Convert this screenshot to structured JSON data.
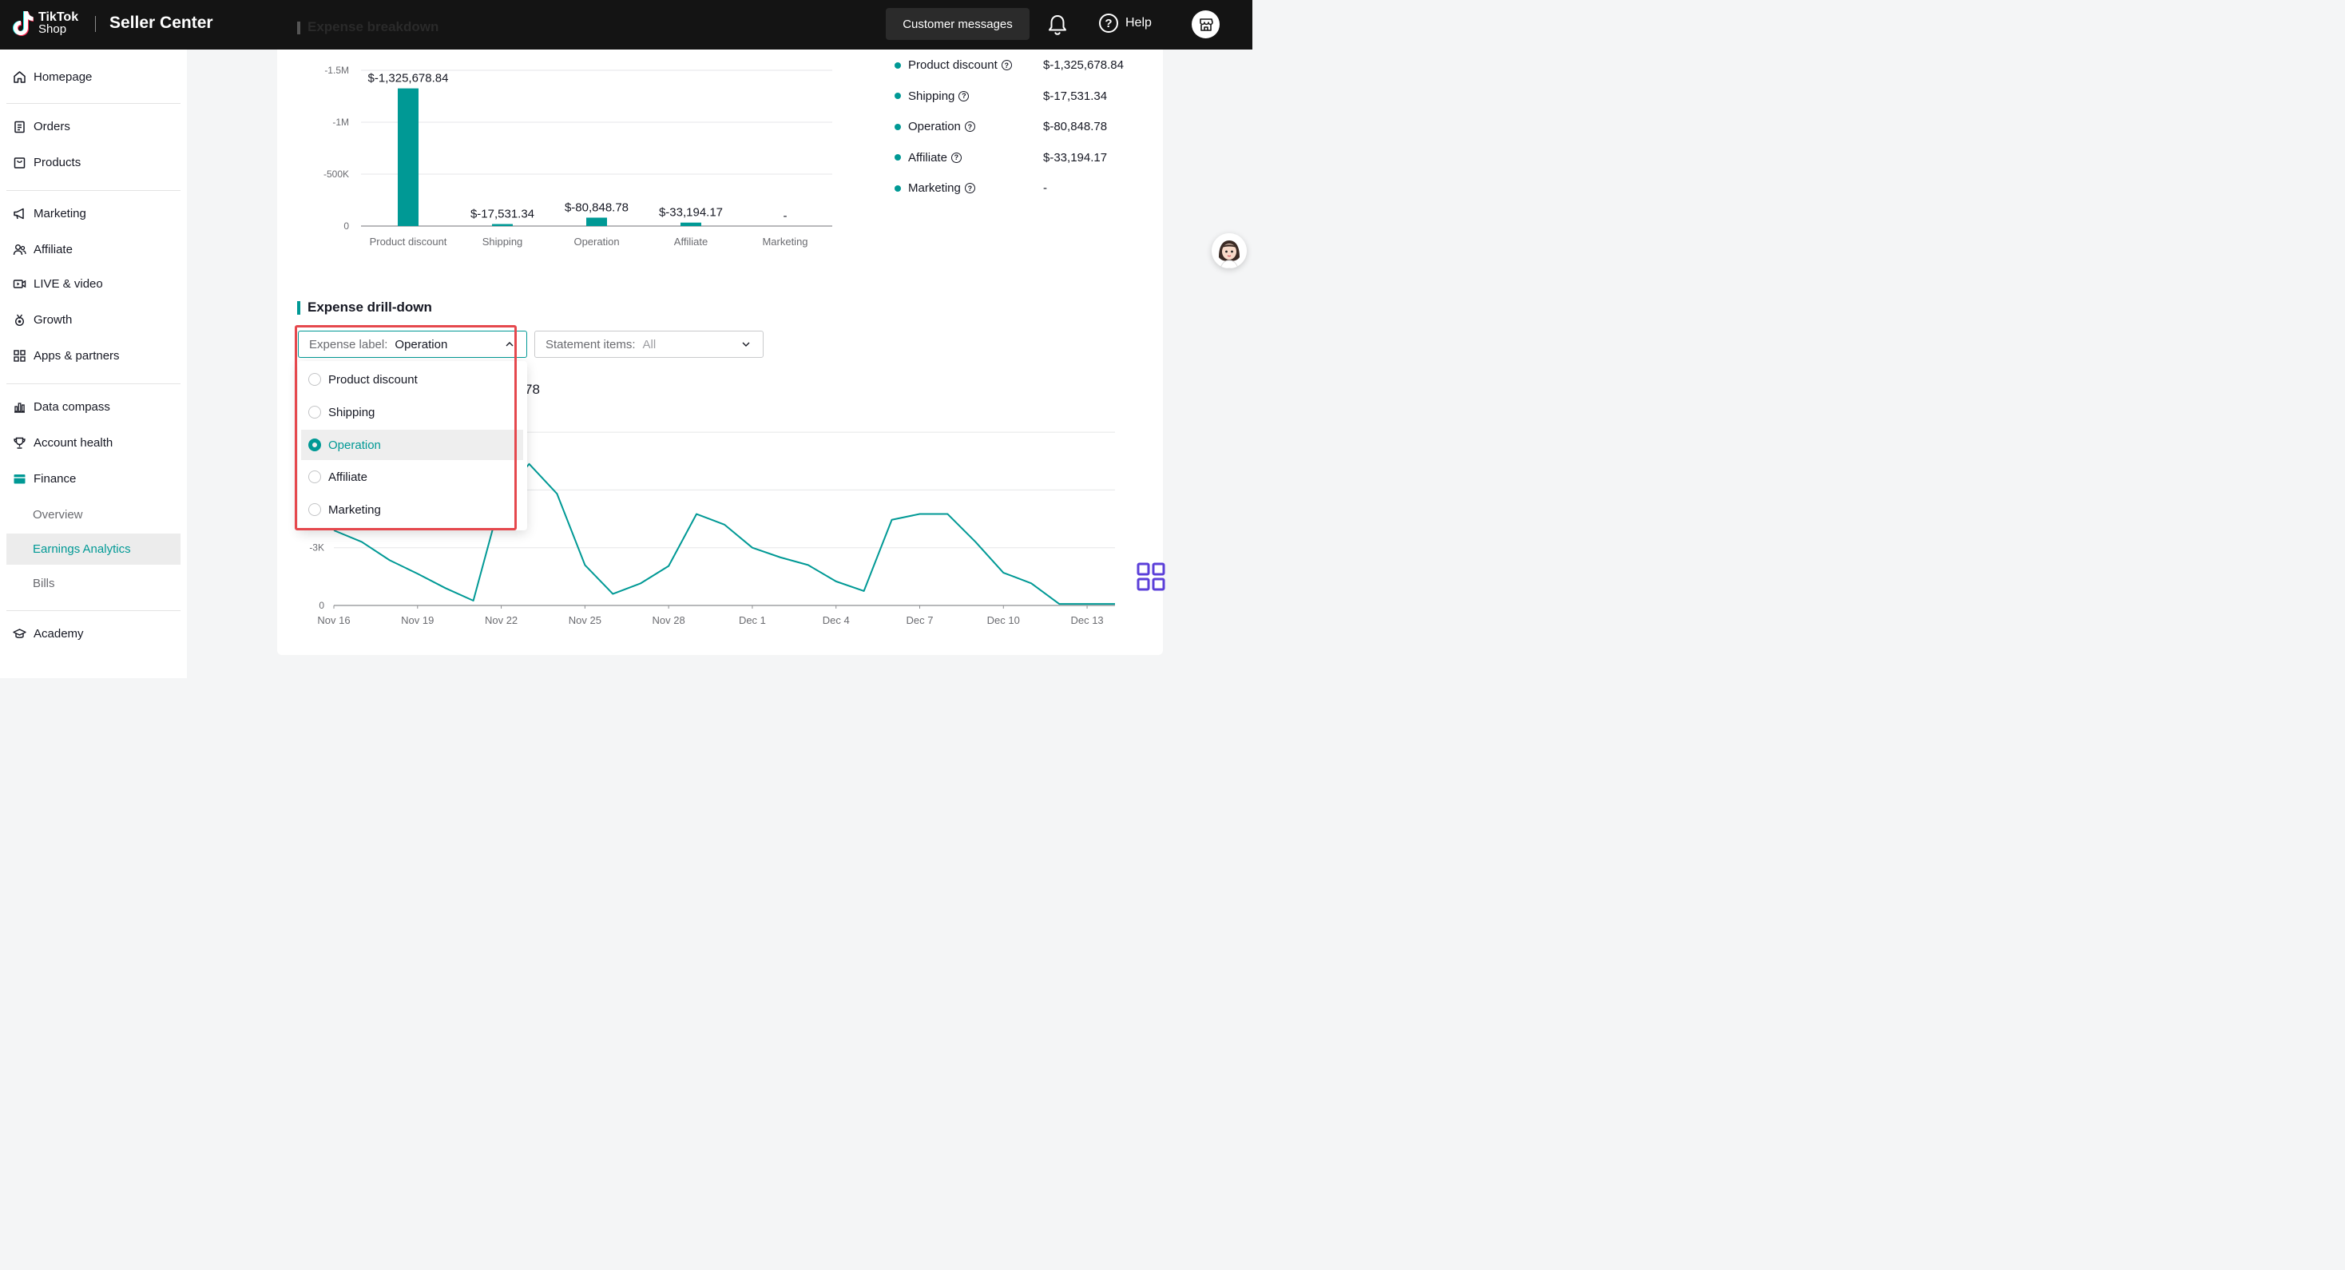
{
  "header": {
    "logo_line1": "TikTok",
    "logo_line2": "Shop",
    "app_title": "Seller Center",
    "messages_label": "Customer messages",
    "help_label": "Help"
  },
  "sidebar": {
    "items": [
      {
        "label": "Homepage",
        "icon": "home-icon"
      },
      {
        "label": "Orders",
        "icon": "clipboard-icon"
      },
      {
        "label": "Products",
        "icon": "bag-icon"
      },
      {
        "label": "Marketing",
        "icon": "megaphone-icon"
      },
      {
        "label": "Affiliate",
        "icon": "users-icon"
      },
      {
        "label": "LIVE & video",
        "icon": "video-icon"
      },
      {
        "label": "Growth",
        "icon": "medal-icon"
      },
      {
        "label": "Apps & partners",
        "icon": "apps-icon"
      },
      {
        "label": "Data compass",
        "icon": "chart-icon"
      },
      {
        "label": "Account health",
        "icon": "trophy-icon"
      },
      {
        "label": "Finance",
        "icon": "wallet-icon"
      },
      {
        "label": "Academy",
        "icon": "graduation-cap-icon"
      }
    ],
    "finance_sub": [
      "Overview",
      "Earnings Analytics",
      "Bills"
    ],
    "active_sub": "Earnings Analytics"
  },
  "breakdown": {
    "title": "Expense breakdown",
    "legend": [
      {
        "label": "Product discount",
        "value": "$-1,325,678.84"
      },
      {
        "label": "Shipping",
        "value": "$-17,531.34"
      },
      {
        "label": "Operation",
        "value": "$-80,848.78"
      },
      {
        "label": "Affiliate",
        "value": "$-33,194.17"
      },
      {
        "label": "Marketing",
        "value": "-"
      }
    ]
  },
  "drilldown": {
    "title": "Expense drill-down",
    "expense_label_prefix": "Expense label:",
    "expense_label_value": "Operation",
    "statement_prefix": "Statement items:",
    "statement_value": "All",
    "partial_total": "78",
    "options": [
      "Product discount",
      "Shipping",
      "Operation",
      "Affiliate",
      "Marketing"
    ],
    "selected_option": "Operation"
  },
  "colors": {
    "accent": "#009995",
    "highlight": "#e5484d",
    "header_bg": "#141414"
  },
  "chart_data": [
    {
      "type": "bar",
      "categories": [
        "Product discount",
        "Shipping",
        "Operation",
        "Affiliate",
        "Marketing"
      ],
      "values": [
        -1325678.84,
        -17531.34,
        -80848.78,
        -33194.17,
        null
      ],
      "data_labels": [
        "$-1,325,678.84",
        "$-17,531.34",
        "$-80,848.78",
        "$-33,194.17",
        "-"
      ],
      "yticks": [
        "-1.5M",
        "-1M",
        "-500K",
        "0"
      ],
      "ytick_values": [
        -1500000,
        -1000000,
        -500000,
        0
      ],
      "grid": true
    },
    {
      "type": "line",
      "x": [
        "Nov 16",
        "Nov 17",
        "Nov 18",
        "Nov 19",
        "Nov 20",
        "Nov 21",
        "Nov 22",
        "Nov 23",
        "Nov 24",
        "Nov 25",
        "Nov 26",
        "Nov 27",
        "Nov 28",
        "Nov 29",
        "Nov 30",
        "Dec 1",
        "Dec 2",
        "Dec 3",
        "Dec 4",
        "Dec 5",
        "Dec 6",
        "Dec 7",
        "Dec 8",
        "Dec 9",
        "Dec 10",
        "Dec 11",
        "Dec 12",
        "Dec 13",
        "Dec 14"
      ],
      "y": [
        -3900,
        -3300,
        -2350,
        -1650,
        -900,
        -250,
        -5600,
        -7350,
        -5800,
        -2100,
        -600,
        -1150,
        -2050,
        -4750,
        -4200,
        -3000,
        -2500,
        -2100,
        -1250,
        -750,
        -4450,
        -4750,
        -4750,
        -3300,
        -1700,
        -1150,
        -80,
        -80,
        -80
      ],
      "xticks": [
        "Nov 16",
        "Nov 19",
        "Nov 22",
        "Nov 25",
        "Nov 28",
        "Dec 1",
        "Dec 4",
        "Dec 7",
        "Dec 10",
        "Dec 13"
      ],
      "yticks_visible": [
        "-3K",
        "0"
      ],
      "grid": true
    }
  ]
}
